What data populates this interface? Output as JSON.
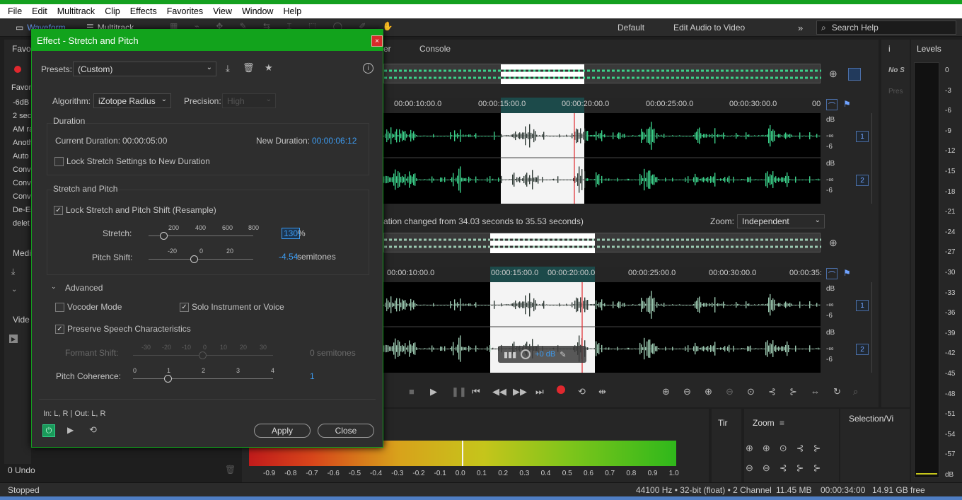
{
  "menu": [
    "File",
    "Edit",
    "Multitrack",
    "Clip",
    "Effects",
    "Favorites",
    "View",
    "Window",
    "Help"
  ],
  "toolbar": {
    "waveform_tab": "Waveform",
    "multitrack_tab": "Multitrack",
    "workspaces": [
      "Default",
      "Edit Audio to Video"
    ],
    "search_placeholder": "Search Help"
  },
  "left_panel": {
    "favorites_label": "Favor",
    "favorites_sub": "Favor",
    "items": [
      "-6dB",
      "2 sec",
      "AM ra",
      "Anoth",
      "Auto",
      "Conv",
      "Conv",
      "Conv",
      "De-Es",
      "delet"
    ],
    "media_label": "Medi",
    "video_label": "Vide",
    "undo": "0 Undo"
  },
  "editor": {
    "console_tab": "Console",
    "editor_tab": "er",
    "ruler1": [
      "00:00:10:00.0",
      "00:00:15:00.0",
      "00:00:20:00.0",
      "00:00:25:00.0",
      "00:00:30:00.0",
      "00"
    ],
    "ruler2": [
      "00:00:10:00.0",
      "00:00:15:00.0",
      "00:00:20:00.0",
      "00:00:25:00.0",
      "00:00:30:00.0",
      "00:00:35:"
    ],
    "db_labels": [
      "dB",
      "-∞",
      "-6"
    ],
    "channels": [
      "1",
      "2",
      "1",
      "2"
    ],
    "message": "ation changed from 34.03 seconds to 35.53 seconds)",
    "zoom_label": "Zoom:",
    "zoom_value": "Independent",
    "hud_db": "+0 dB"
  },
  "dialog": {
    "title": "Effect - Stretch and Pitch",
    "presets_label": "Presets:",
    "presets_value": "(Custom)",
    "algorithm_label": "Algorithm:",
    "algorithm_value": "iZotope Radius",
    "precision_label": "Precision:",
    "precision_value": "High",
    "duration_group": "Duration",
    "current_duration_label": "Current Duration:",
    "current_duration_value": "00:00:05:00",
    "new_duration_label": "New Duration:",
    "new_duration_value": "00:00:06:12",
    "lock_stretch_label": "Lock Stretch Settings to New Duration",
    "stretch_pitch_group": "Stretch and Pitch",
    "lock_pitch_label": "Lock Stretch and Pitch Shift (Resample)",
    "stretch_label": "Stretch:",
    "stretch_ticks": [
      "200",
      "400",
      "600",
      "800"
    ],
    "stretch_value": "130",
    "stretch_unit": "%",
    "pitch_label": "Pitch Shift:",
    "pitch_ticks": [
      "-20",
      "0",
      "20"
    ],
    "pitch_value": "-4.54",
    "pitch_unit": "semitones",
    "advanced_label": "Advanced",
    "vocoder_label": "Vocoder Mode",
    "solo_label": "Solo Instrument or Voice",
    "preserve_label": "Preserve Speech Characteristics",
    "formant_label": "Formant Shift:",
    "formant_ticks": [
      "-30",
      "-20",
      "-10",
      "0",
      "10",
      "20",
      "30"
    ],
    "formant_value": "0 semitones",
    "coherence_label": "Pitch Coherence:",
    "coherence_ticks": [
      "0",
      "1",
      "2",
      "3",
      "4"
    ],
    "coherence_value": "1",
    "io_label": "In: L, R | Out: L, R",
    "apply_label": "Apply",
    "close_label": "Close"
  },
  "levels": {
    "title": "Levels",
    "scale": [
      "0",
      "-3",
      "-6",
      "-9",
      "-12",
      "-15",
      "-18",
      "-21",
      "-24",
      "-27",
      "-30",
      "-33",
      "-36",
      "-39",
      "-42",
      "-45",
      "-48",
      "-51",
      "-54",
      "-57",
      "dB"
    ]
  },
  "meter_scale": [
    "-0.9",
    "-0.8",
    "-0.7",
    "-0.6",
    "-0.5",
    "-0.4",
    "-0.3",
    "-0.2",
    "-0.1",
    "0.0",
    "0.1",
    "0.2",
    "0.3",
    "0.4",
    "0.5",
    "0.6",
    "0.7",
    "0.8",
    "0.9",
    "1.0"
  ],
  "panels": {
    "time_tab": "Tir",
    "zoom_tab": "Zoom",
    "selection_tab": "Selection/Vi",
    "no_sel": "No S",
    "pres": "Pres"
  },
  "status": {
    "state": "Stopped",
    "format": "44100 Hz • 32-bit (float) • 2 Channel",
    "size": "11.45 MB",
    "duration": "00:00:34:00",
    "free": "14.91 GB free"
  }
}
